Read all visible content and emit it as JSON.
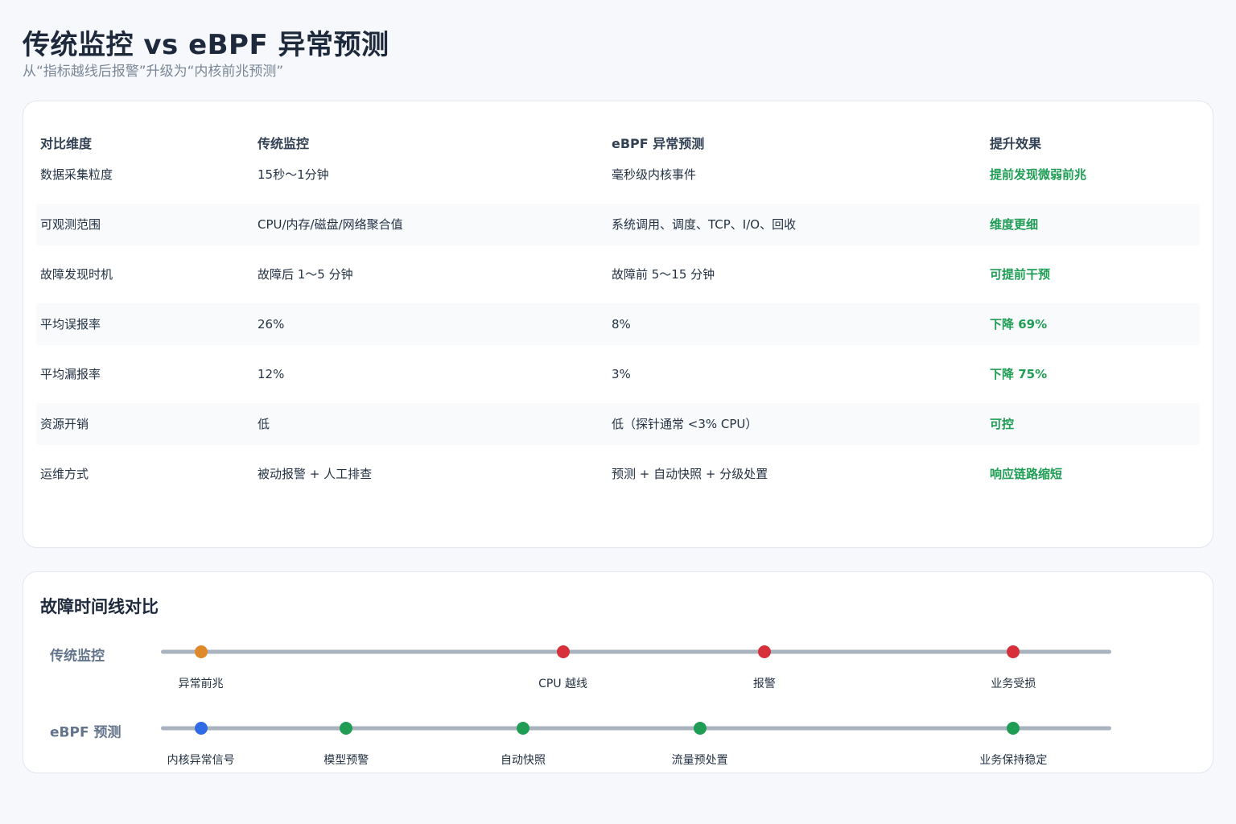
{
  "header": {
    "title": "传统监控 vs eBPF 异常预测",
    "subtitle": "从“指标越线后报警”升级为“内核前兆预测”"
  },
  "comparison": {
    "columns": [
      "对比维度",
      "传统监控",
      "eBPF 异常预测",
      "提升效果"
    ],
    "rows": [
      {
        "dimension": "数据采集粒度",
        "traditional": "15秒～1分钟",
        "ebpf": "毫秒级内核事件",
        "effect": "提前发现微弱前兆"
      },
      {
        "dimension": "可观测范围",
        "traditional": "CPU/内存/磁盘/网络聚合值",
        "ebpf": "系统调用、调度、TCP、I/O、回收",
        "effect": "维度更细"
      },
      {
        "dimension": "故障发现时机",
        "traditional": "故障后 1～5 分钟",
        "ebpf": "故障前 5～15 分钟",
        "effect": "可提前干预"
      },
      {
        "dimension": "平均误报率",
        "traditional": "26%",
        "ebpf": "8%",
        "effect": "下降 69%"
      },
      {
        "dimension": "平均漏报率",
        "traditional": "12%",
        "ebpf": "3%",
        "effect": "下降 75%"
      },
      {
        "dimension": "资源开销",
        "traditional": "低",
        "ebpf": "低（探针通常 <3% CPU）",
        "effect": "可控"
      },
      {
        "dimension": "运维方式",
        "traditional": "被动报警 + 人工排查",
        "ebpf": "预测 + 自动快照 + 分级处置",
        "effect": "响应链路缩短"
      }
    ]
  },
  "timeline": {
    "title": "故障时间线对比",
    "tracks": [
      {
        "label": "传统监控",
        "events": [
          {
            "label": "异常前兆",
            "position": 0.042,
            "color": "#e0892b"
          },
          {
            "label": "CPU 越线",
            "position": 0.423,
            "color": "#d7303b"
          },
          {
            "label": "报警",
            "position": 0.635,
            "color": "#d7303b"
          },
          {
            "label": "业务受损",
            "position": 0.897,
            "color": "#d7303b"
          }
        ]
      },
      {
        "label": "eBPF 预测",
        "events": [
          {
            "label": "内核异常信号",
            "position": 0.042,
            "color": "#2f6be4"
          },
          {
            "label": "模型预警",
            "position": 0.195,
            "color": "#1f9d55"
          },
          {
            "label": "自动快照",
            "position": 0.381,
            "color": "#1f9d55"
          },
          {
            "label": "流量预处置",
            "position": 0.567,
            "color": "#1f9d55"
          },
          {
            "label": "业务保持稳定",
            "position": 0.897,
            "color": "#1f9d55"
          }
        ]
      }
    ]
  }
}
